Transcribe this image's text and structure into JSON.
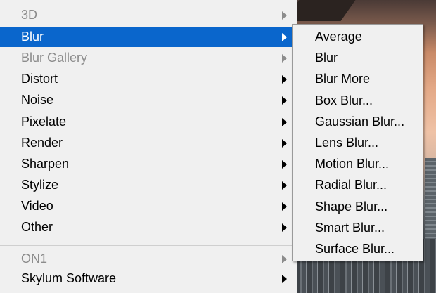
{
  "main_menu": {
    "items": [
      {
        "label": "3D",
        "state": "disabled",
        "has_submenu": true
      },
      {
        "label": "Blur",
        "state": "selected",
        "has_submenu": true
      },
      {
        "label": "Blur Gallery",
        "state": "disabled",
        "has_submenu": true
      },
      {
        "label": "Distort",
        "state": "enabled",
        "has_submenu": true
      },
      {
        "label": "Noise",
        "state": "enabled",
        "has_submenu": true
      },
      {
        "label": "Pixelate",
        "state": "enabled",
        "has_submenu": true
      },
      {
        "label": "Render",
        "state": "enabled",
        "has_submenu": true
      },
      {
        "label": "Sharpen",
        "state": "enabled",
        "has_submenu": true
      },
      {
        "label": "Stylize",
        "state": "enabled",
        "has_submenu": true
      },
      {
        "label": "Video",
        "state": "enabled",
        "has_submenu": true
      },
      {
        "label": "Other",
        "state": "enabled",
        "has_submenu": true
      },
      {
        "label": "ON1",
        "state": "disabled",
        "has_submenu": true
      },
      {
        "label": "Skylum Software",
        "state": "enabled",
        "has_submenu": true
      }
    ]
  },
  "blur_submenu": {
    "items": [
      {
        "label": "Average"
      },
      {
        "label": "Blur"
      },
      {
        "label": "Blur More"
      },
      {
        "label": "Box Blur..."
      },
      {
        "label": "Gaussian Blur..."
      },
      {
        "label": "Lens Blur..."
      },
      {
        "label": "Motion Blur..."
      },
      {
        "label": "Radial Blur..."
      },
      {
        "label": "Shape Blur..."
      },
      {
        "label": "Smart Blur..."
      },
      {
        "label": "Surface Blur..."
      }
    ]
  },
  "colors": {
    "menu_background": "#f0f0f0",
    "selection": "#0a66cc",
    "disabled_text": "#8c8c8c"
  },
  "icons": {
    "submenu_arrow": "triangle-right-icon"
  }
}
